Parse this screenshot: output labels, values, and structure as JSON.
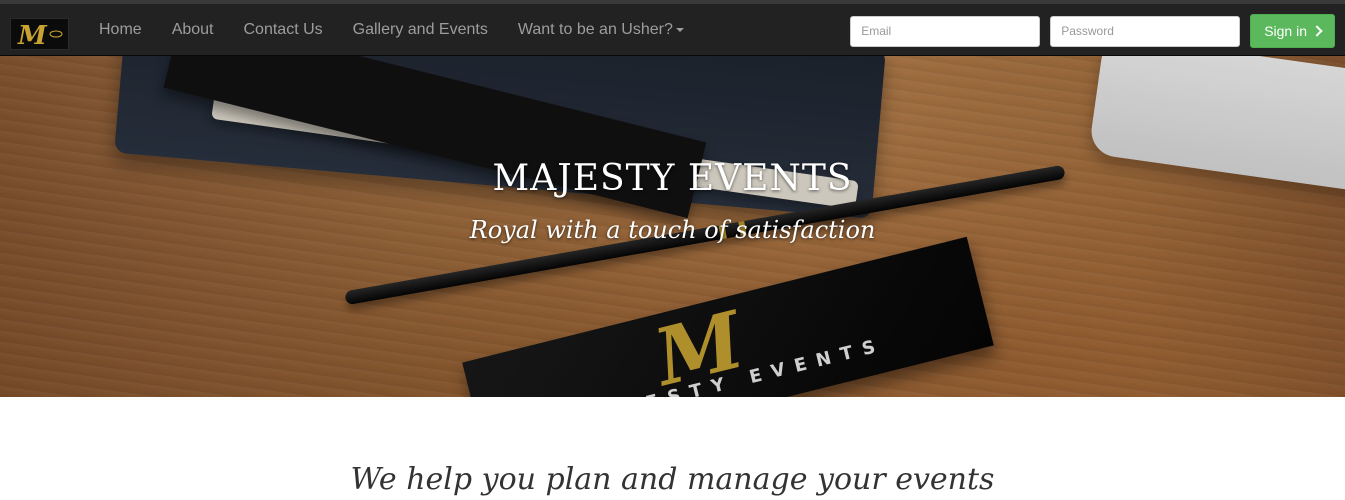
{
  "navbar": {
    "brand_logo_text": "M",
    "items": [
      {
        "label": "Home"
      },
      {
        "label": "About"
      },
      {
        "label": "Contact Us"
      },
      {
        "label": "Gallery and Events"
      },
      {
        "label": "Want to be an Usher?"
      }
    ],
    "login": {
      "email_placeholder": "Email",
      "password_placeholder": "Password",
      "signin_label": "Sign in"
    }
  },
  "hero": {
    "title": "MAJESTY EVENTS",
    "tagline": "Royal with a touch of satisfaction",
    "card_logo_letter": "M",
    "card_text": "MAJESTY EVENTS"
  },
  "main": {
    "headline": "We help you plan and manage your events"
  },
  "colors": {
    "navbar_bg": "#222222",
    "signin_green": "#5cb85c",
    "hero_text": "#ffffff"
  }
}
